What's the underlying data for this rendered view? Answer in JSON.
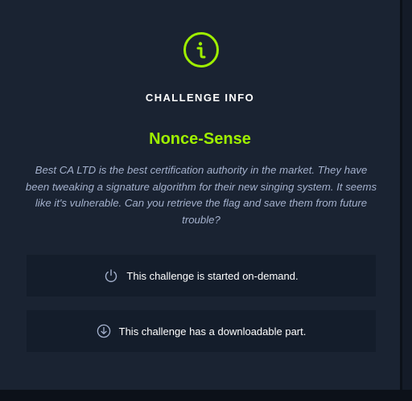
{
  "panel": {
    "icon": "info-circle-icon",
    "section_title": "CHALLENGE INFO",
    "challenge_name": "Nonce-Sense",
    "description": "Best CA LTD is the best certification authority in the market. They have been tweaking a signature algorithm for their new singing system. It seems like it's vulnerable. Can you retrieve the flag and save them from future trouble?",
    "features": [
      {
        "icon": "power-icon",
        "label": "This challenge is started on-demand."
      },
      {
        "icon": "download-icon",
        "label": "This challenge has a downloadable part."
      }
    ]
  },
  "colors": {
    "background": "#0c1119",
    "card": "#1a2332",
    "feature_box": "#141d2b",
    "accent": "#9fef00",
    "description_text": "#a4b1cd",
    "heading_text": "#ffffff",
    "icon_muted": "#a4b1cd"
  }
}
